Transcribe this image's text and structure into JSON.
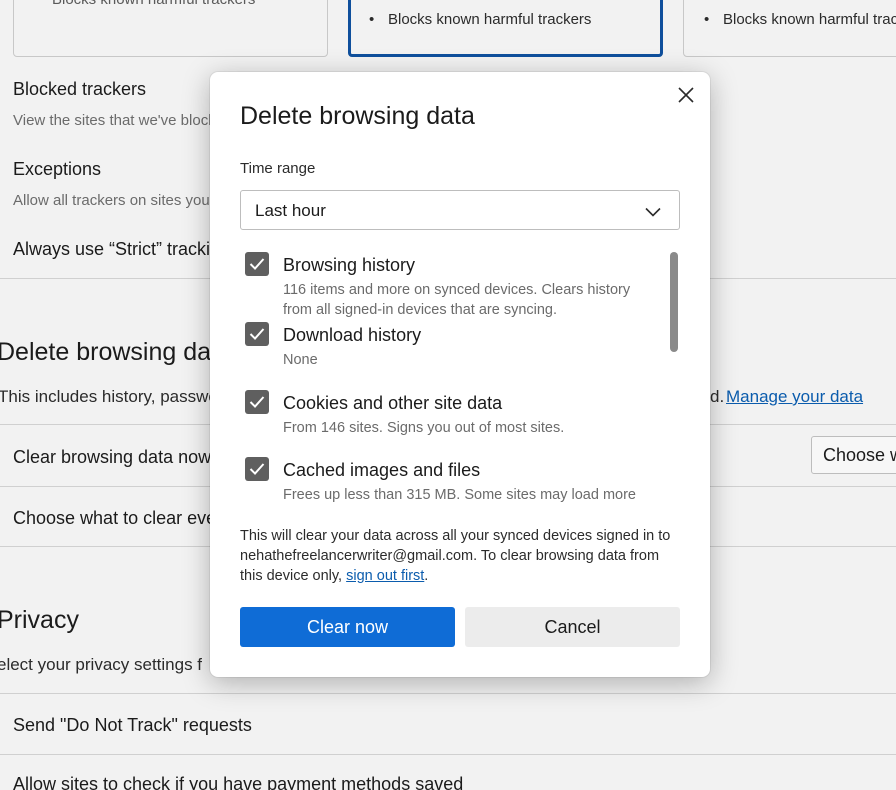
{
  "background": {
    "cards": [
      {
        "bullet": "Blocks known harmful trackers"
      },
      {
        "bullet": "Blocks known harmful trackers"
      },
      {
        "bullet": "Blocks known harmful trac"
      }
    ],
    "blocked_trackers": {
      "title": "Blocked trackers",
      "desc": "View the sites that we've block"
    },
    "exceptions": {
      "title": "Exceptions",
      "desc": "Allow all trackers on sites you"
    },
    "strict": "Always use “Strict” tracki",
    "delete_section": {
      "title": "Delete browsing da",
      "desc": "This includes history, passwo",
      "desc_tail": "d.",
      "manage_link": "Manage your data"
    },
    "clear_now_row": "Clear browsing data now",
    "choose_button": "Choose w",
    "choose_every": "Choose what to clear eve",
    "privacy": {
      "title": "Privacy",
      "desc": "elect your privacy settings f"
    },
    "dnt": "Send \"Do Not Track\" requests",
    "payment": "Allow sites to check if you have payment methods saved"
  },
  "dialog": {
    "title": "Delete browsing data",
    "time_range_label": "Time range",
    "time_range_value": "Last hour",
    "options": [
      {
        "title": "Browsing history",
        "desc": "116 items and more on synced devices. Clears history from all signed-in devices that are syncing.",
        "checked": true
      },
      {
        "title": "Download history",
        "desc": "None",
        "checked": true
      },
      {
        "title": "Cookies and other site data",
        "desc": "From 146 sites. Signs you out of most sites.",
        "checked": true
      },
      {
        "title": "Cached images and files",
        "desc": "Frees up less than 315 MB. Some sites may load more",
        "checked": true
      }
    ],
    "notice": "This will clear your data across all your synced devices signed in to nehathefreelancerwriter@gmail.com. To clear browsing data from this device only,",
    "sign_out_link": "sign out first",
    "notice_end": ".",
    "clear_button": "Clear now",
    "cancel_button": "Cancel",
    "colors": {
      "primary": "#0f6cd6",
      "checkbox": "#5f5f5f",
      "link": "#0b5cad"
    }
  }
}
